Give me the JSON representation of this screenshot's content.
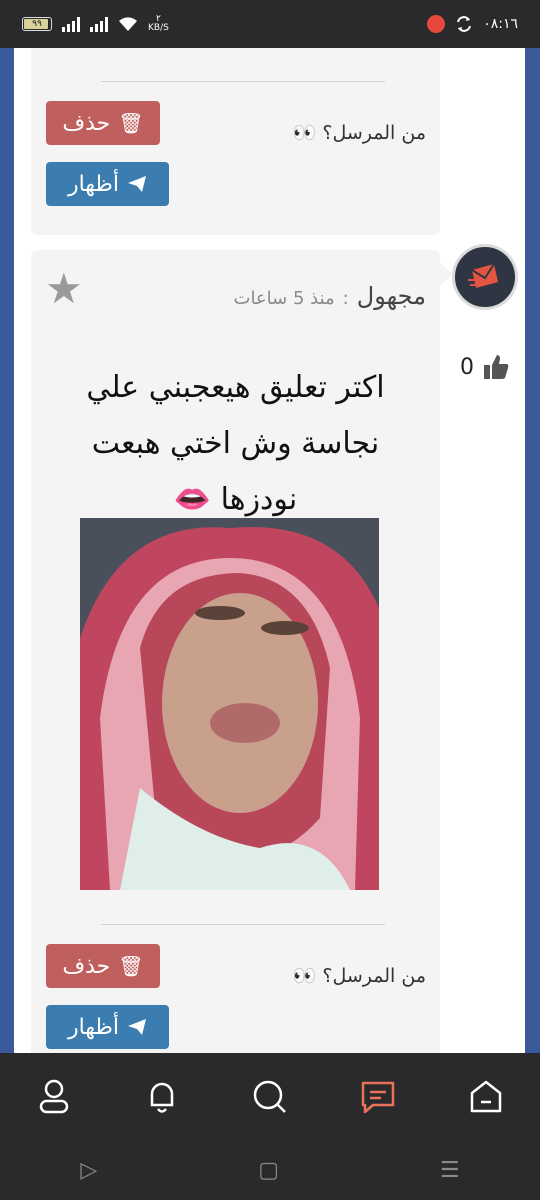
{
  "status_bar": {
    "time": "٠٨:١٦",
    "battery": "٩٩",
    "net_speed_value": "٢",
    "net_speed_unit": "KB/S"
  },
  "card_top": {
    "sender_label": "من المرسل؟",
    "sender_emoji": "👀",
    "delete_label": "حذف",
    "show_label": "أظهار"
  },
  "post": {
    "author": "مجهول",
    "separator": ":",
    "time": "منذ 5 ساعات",
    "message": "اكتر تعليق هيعجبني علي نجاسة وش اختي هبعت نودزها 👄",
    "likes": "0",
    "sender_label": "من المرسل؟",
    "sender_emoji": "👀",
    "delete_label": "حذف",
    "show_label": "أظهار"
  },
  "colors": {
    "delete": "#c0605e",
    "show": "#3b7db0",
    "side": "#3b5a9c",
    "nav_active": "#e8735a"
  },
  "nav": {
    "items": [
      "profile-icon",
      "bell-icon",
      "search-icon",
      "messages-icon",
      "home-icon"
    ],
    "active": "messages-icon"
  },
  "system_nav": [
    "back-icon",
    "home-square-icon",
    "menu-icon"
  ]
}
